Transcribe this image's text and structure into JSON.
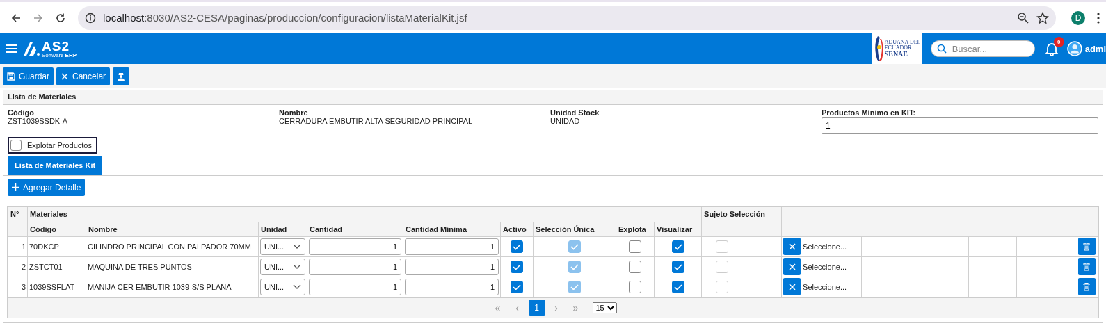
{
  "browser": {
    "url_host": "localhost",
    "url_rest": ":8030/AS2-CESA/paginas/produccion/configuracion/listaMaterialKit.jsf",
    "profile": "D"
  },
  "app_bar": {
    "logo": "AS2",
    "logo_sub_1": "Software",
    "logo_sub_2": "ERP",
    "partner_logo": [
      "ADUANA DEL",
      "ECUADOR",
      "SENAE"
    ],
    "search": {
      "placeholder": "Buscar..."
    },
    "notifications": "0",
    "user": "admi"
  },
  "toolbar": [
    {
      "kind": "save",
      "label": "Guardar"
    },
    {
      "kind": "cancel",
      "label": "Cancelar"
    },
    {
      "kind": "person"
    }
  ],
  "panel": {
    "title": "Lista de Materiales",
    "fields": [
      {
        "label": "Código",
        "value": "ZST1039SSDK-A"
      },
      {
        "label": "Nombre",
        "value": "CERRADURA EMBUTIR ALTA SEGURIDAD PRINCIPAL"
      },
      {
        "label": "Unidad Stock",
        "value": "UNIDAD"
      },
      {
        "label": "Productos Mínimo en KIT:",
        "input": "1"
      }
    ],
    "explotar": {
      "label": "Explotar Productos",
      "checked": false
    },
    "tabs": [
      {
        "label": "Lista de Materiales Kit",
        "selected": true
      }
    ],
    "add_button": "Agregar Detalle"
  },
  "table": {
    "header_top": [
      "N°",
      "Materiales",
      "Sujeto Selección"
    ],
    "columns": [
      "Código",
      "Nombre",
      "Unidad",
      "Cantidad",
      "Cantidad Mínima",
      "Activo",
      "Selección Única",
      "Explota",
      "Visualizar"
    ],
    "rows": [
      {
        "n": "1",
        "codigo": "70DKCP",
        "nombre": "CILINDRO PRINCIPAL CON PALPADOR 70MM",
        "unidad": "UNI...",
        "cantidad": "1",
        "cantidad_minima": "1",
        "activo": true,
        "seleccion_unica": true,
        "explota": false,
        "visualizar": true,
        "sujeto_seleccion": false,
        "seleccion": "Seleccione..."
      },
      {
        "n": "2",
        "codigo": "ZSTCT01",
        "nombre": "MAQUINA DE TRES PUNTOS",
        "unidad": "UNI...",
        "cantidad": "1",
        "cantidad_minima": "1",
        "activo": true,
        "seleccion_unica": true,
        "explota": false,
        "visualizar": true,
        "sujeto_seleccion": false,
        "seleccion": "Seleccione..."
      },
      {
        "n": "3",
        "codigo": "1039SSFLAT",
        "nombre": "MANIJA CER EMBUTIR 1039-S/S PLANA",
        "unidad": "UNI...",
        "cantidad": "1",
        "cantidad_minima": "1",
        "activo": true,
        "seleccion_unica": true,
        "explota": false,
        "visualizar": true,
        "sujeto_seleccion": false,
        "seleccion": "Seleccione..."
      }
    ],
    "pagination": {
      "first": "«",
      "prev": "‹",
      "pages": [
        {
          "label": "1",
          "selected": true
        }
      ],
      "next": "›",
      "last": "»",
      "page_size": "15"
    }
  }
}
